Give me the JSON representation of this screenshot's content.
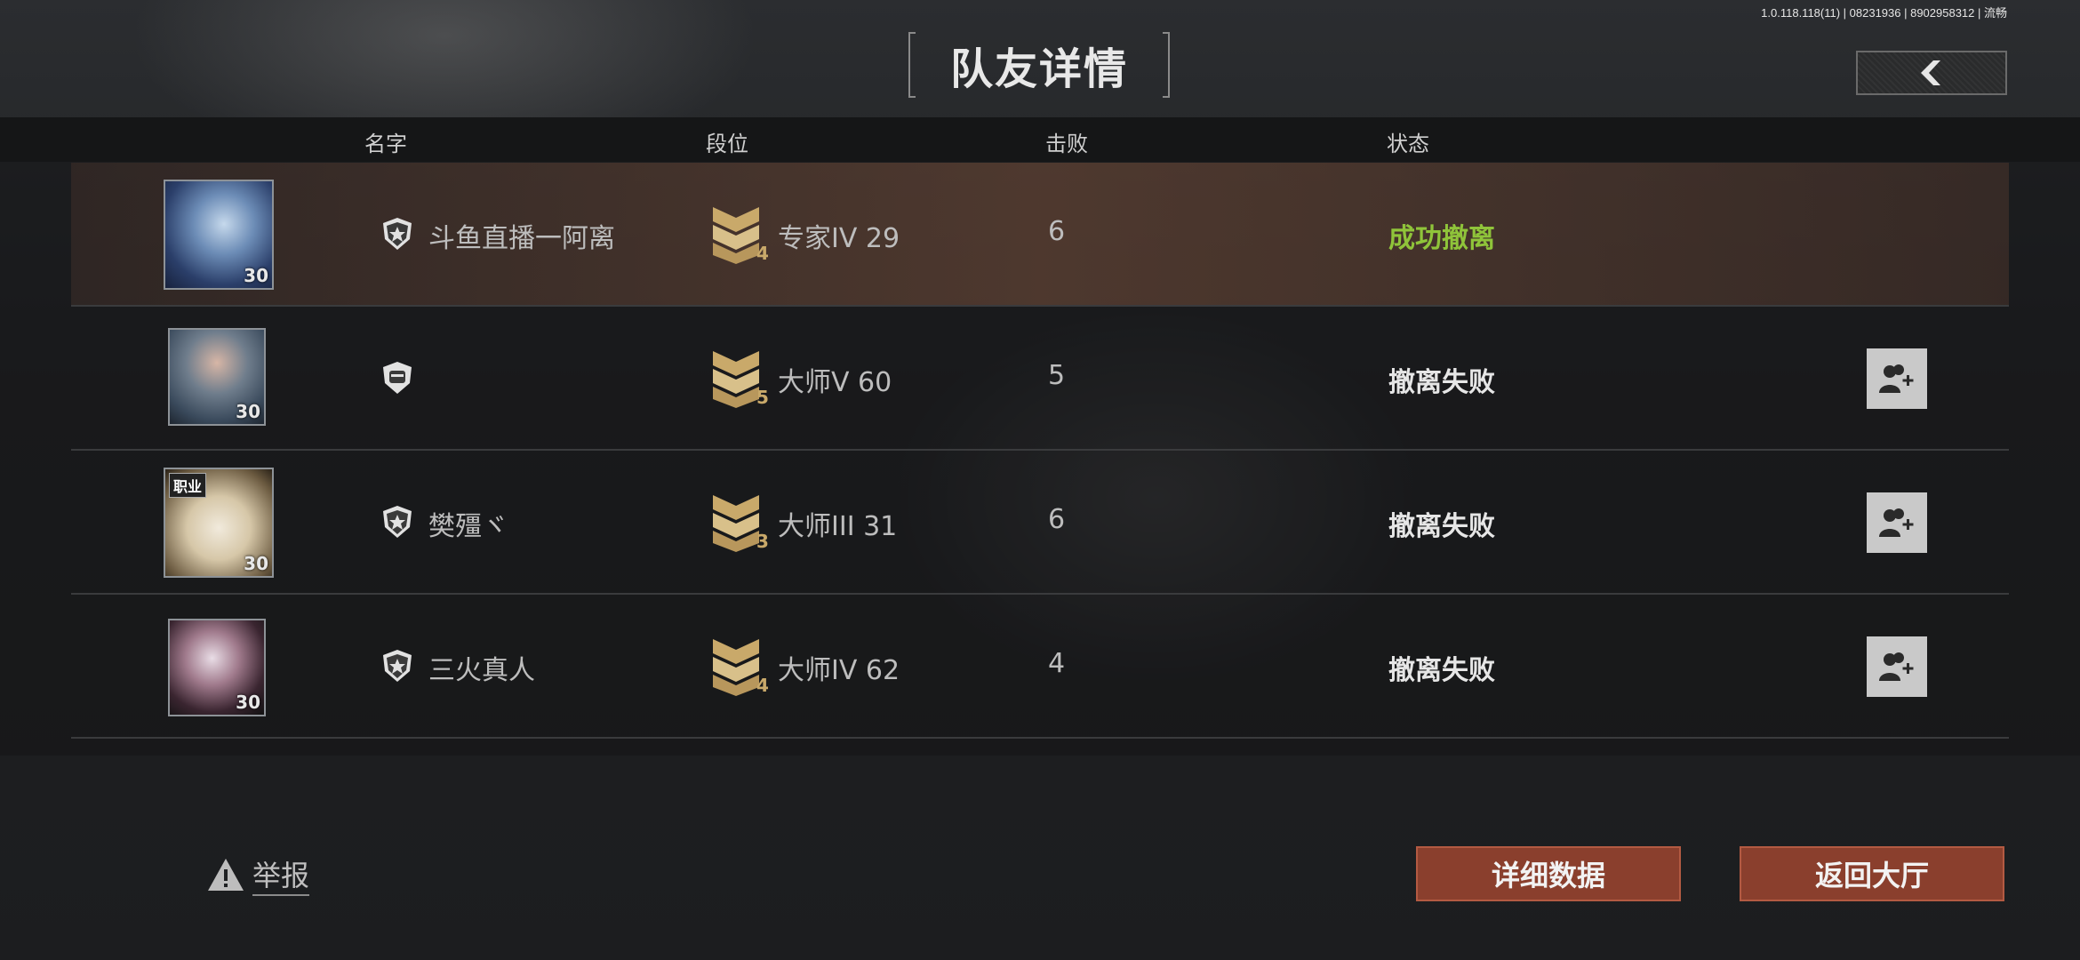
{
  "version_info": "1.0.118.118(11) | 08231936 | 8902958312 | 流畅",
  "title": "队友详情",
  "header": {
    "name": "名字",
    "rank": "段位",
    "kills": "击败",
    "status": "状态"
  },
  "rows": [
    {
      "level": "30",
      "tag": "",
      "name": "斗鱼直播一阿离",
      "rank_tier": "4",
      "rank": "专家IV 29",
      "kills": "6",
      "status": "成功撤离",
      "status_type": "success",
      "has_add_friend": false
    },
    {
      "level": "30",
      "tag": "",
      "name": "",
      "rank_tier": "5",
      "rank": "大师V 60",
      "kills": "5",
      "status": "撤离失败",
      "status_type": "fail",
      "has_add_friend": true
    },
    {
      "level": "30",
      "tag": "职业",
      "name": "樊殭ヾ",
      "rank_tier": "3",
      "rank": "大师III 31",
      "kills": "6",
      "status": "撤离失败",
      "status_type": "fail",
      "has_add_friend": true
    },
    {
      "level": "30",
      "tag": "",
      "name": "三火真人",
      "rank_tier": "4",
      "rank": "大师IV 62",
      "kills": "4",
      "status": "撤离失败",
      "status_type": "fail",
      "has_add_friend": true
    }
  ],
  "footer": {
    "report": "举报",
    "details": "详细数据",
    "return": "返回大厅"
  },
  "colors": {
    "success": "#8fc43a",
    "button": "#8a3f2d"
  },
  "icons": {
    "back": "chevron-left-icon",
    "shield": "shield-star-icon",
    "rank": "rank-chevron-icon",
    "add_friend": "add-friend-icon",
    "warning": "warning-icon"
  }
}
